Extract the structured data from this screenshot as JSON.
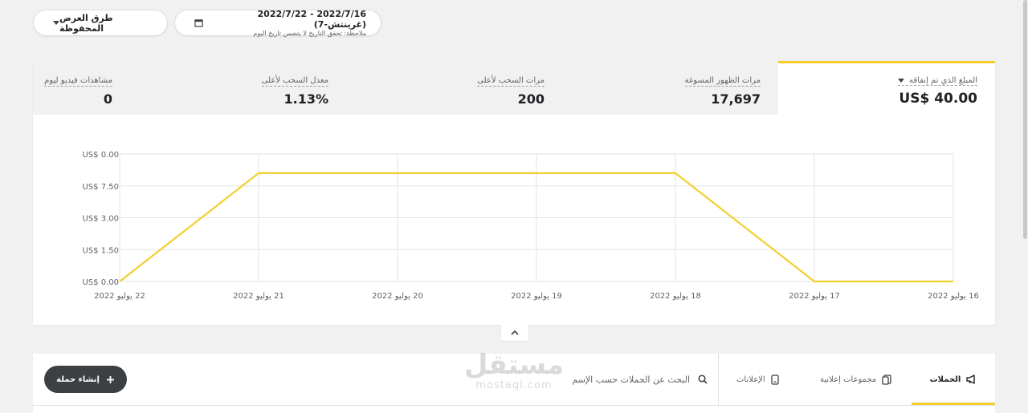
{
  "toolbar": {
    "saved_views_label": "طرق العرض المحفوظة",
    "date_range": "2022/7/16 - 2022/7/22 (غرينتش-7)",
    "date_note": "ملاحظة: تحقق التاريخ لا يتضمن تاريخ اليوم"
  },
  "metrics": {
    "main": {
      "label": "المبلغ الذي تم إنفاقه",
      "value": "US$ 40.00"
    },
    "items": [
      {
        "label": "مرات الظهور المسوغة",
        "value": "17,697"
      },
      {
        "label": "مرات السحب لأعلى",
        "value": "200"
      },
      {
        "label": "معدل السحب لأعلى",
        "value": "1.13%"
      },
      {
        "label": "مشاهدات فيديو ليوم",
        "value": "0"
      }
    ]
  },
  "chart_data": {
    "type": "line",
    "x": [
      "16 يوليو 2022",
      "17 يوليو 2022",
      "18 يوليو 2022",
      "19 يوليو 2022",
      "20 يوليو 2022",
      "21 يوليو 2022",
      "22 يوليو 2022"
    ],
    "y_tick_labels": [
      "US$ 0.00",
      "US$ 1.50",
      "US$ 3.00",
      "US$ 7.50",
      "US$ 0.00"
    ],
    "series": [
      {
        "values": [
          0,
          0,
          8.5,
          8.5,
          8.5,
          8.5,
          0
        ]
      }
    ],
    "ylim": [
      0,
      10
    ],
    "grid": true,
    "color": "#f2d02f"
  },
  "tabs": [
    {
      "label": "الحملات",
      "icon": "megaphone-icon",
      "active": true
    },
    {
      "label": "مجموعات إعلانية",
      "icon": "ad-groups-icon",
      "active": false
    },
    {
      "label": "الإعلانات",
      "icon": "phone-icon",
      "active": false
    }
  ],
  "search": {
    "placeholder": "البحث عن الحملات حسب الإسم"
  },
  "create_button": {
    "label": "إنشاء حملة"
  },
  "watermark": {
    "ar": "مستقل",
    "en": "mostaql.com"
  },
  "colors": {
    "accent": "#f2d02f",
    "dark": "#3c4043",
    "page_bg": "#f1f1f1"
  }
}
